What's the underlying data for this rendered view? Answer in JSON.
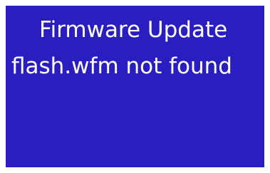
{
  "screen": {
    "title": "Firmware Update",
    "message": "flash.wfm not found",
    "background_color": "#2b1ec0",
    "text_color": "#ffffff"
  }
}
